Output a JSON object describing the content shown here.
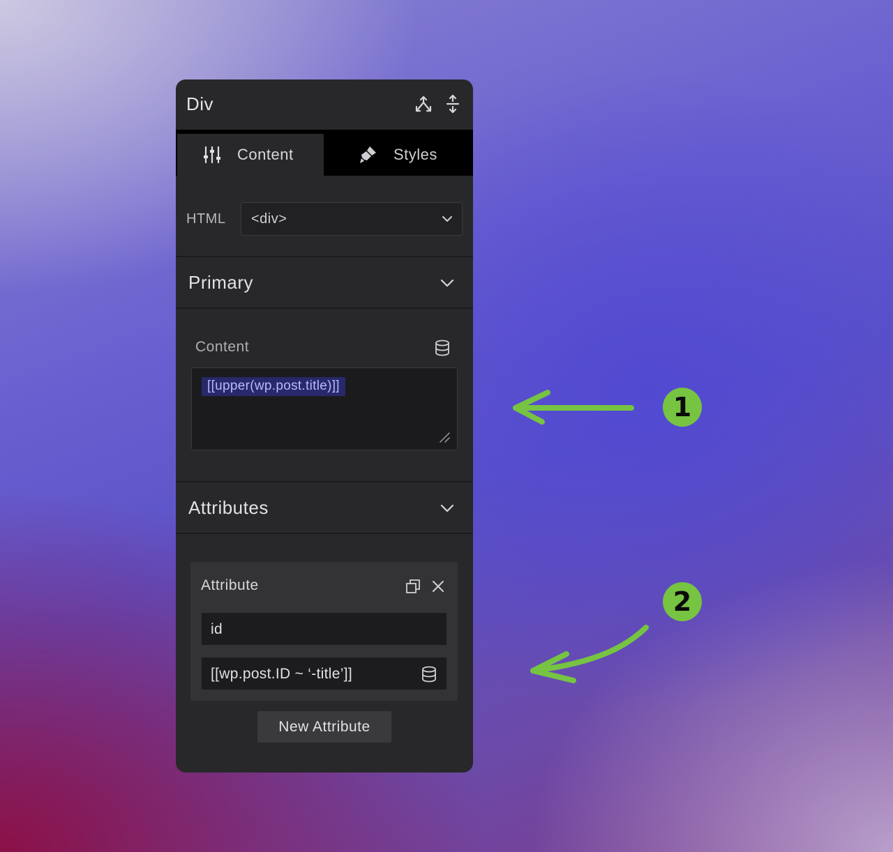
{
  "panel": {
    "title": "Div",
    "header_icons": [
      "structure-icon",
      "move-icon"
    ]
  },
  "tabs": [
    {
      "label": "Content",
      "icon": "sliders-icon",
      "active": true
    },
    {
      "label": "Styles",
      "icon": "brush-icon",
      "active": false
    }
  ],
  "html_row": {
    "label": "HTML",
    "select_value": "<div>"
  },
  "sections": {
    "primary": {
      "title": "Primary"
    },
    "attributes": {
      "title": "Attributes"
    }
  },
  "content_field": {
    "label": "Content",
    "value": "[[upper(wp.post.title)]]"
  },
  "attribute": {
    "title": "Attribute",
    "name_value": "id",
    "value_value": "[[wp.post.ID ~ ‘-title’]]"
  },
  "new_attribute_label": "New Attribute",
  "callouts": [
    {
      "number": "1"
    },
    {
      "number": "2"
    }
  ],
  "colors": {
    "panel_bg": "#28282b",
    "chip_bg": "#27296a",
    "chip_text": "#b5b9ff",
    "callout_green": "#76c442"
  }
}
